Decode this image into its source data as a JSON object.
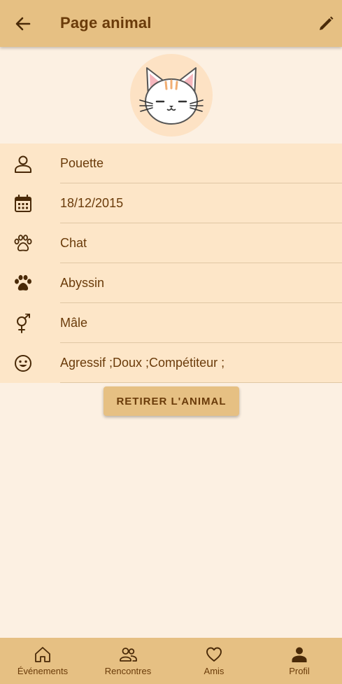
{
  "header": {
    "title": "Page animal",
    "back_icon": "arrow-left-icon",
    "edit_icon": "pencil-icon"
  },
  "avatar": {
    "icon": "cat-face-icon"
  },
  "info": {
    "rows": [
      {
        "icon": "person-icon",
        "value": "Pouette"
      },
      {
        "icon": "calendar-icon",
        "value": "18/12/2015"
      },
      {
        "icon": "paw-outline-icon",
        "value": "Chat"
      },
      {
        "icon": "paw-filled-icon",
        "value": "Abyssin"
      },
      {
        "icon": "gender-icon",
        "value": "Mâle"
      },
      {
        "icon": "smiley-icon",
        "value": "Agressif ;Doux ;Compétiteur ;"
      }
    ]
  },
  "actions": {
    "remove_label": "RETIRER L'ANIMAL"
  },
  "bottom_nav": {
    "items": [
      {
        "label": "Événements",
        "icon": "home-icon"
      },
      {
        "label": "Rencontres",
        "icon": "people-icon"
      },
      {
        "label": "Amis",
        "icon": "heart-icon"
      },
      {
        "label": "Profil",
        "icon": "profile-icon",
        "active": true
      }
    ]
  },
  "colors": {
    "bar": "#e6c083",
    "background": "#fcf0e2",
    "list_background": "#fde6c8",
    "text": "#6a3b0a"
  }
}
